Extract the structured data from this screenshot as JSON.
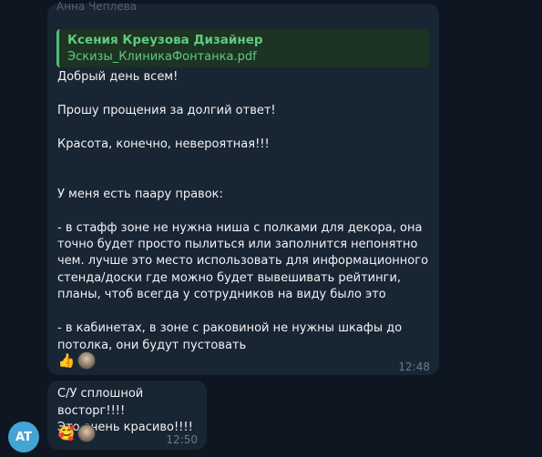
{
  "message1": {
    "sender": "Анна Чеплева",
    "reply": {
      "author": "Ксения Креузова Дизайнер",
      "file": "Эскизы_КлиникаФонтанка.pdf"
    },
    "text": "Добрый день всем!\n\nПрошу прощения за долгий ответ!\n\nКрасота, конечно, невероятная!!!\n\n\nУ меня есть паару правок:\n\n- в стафф зоне не нужна ниша с полками для декора, она точно будет просто пылиться или заполнится непонятно чем. лучше это место использовать для информационного стенда/доски где можно будет вывешивать рейтинги, планы, чтоб всегда у сотрудников на виду было это\n\n- в кабинетах, в зоне с раковиной не нужны шкафы до потолка, они будут пустовать",
    "reaction_emoji": "👍",
    "time": "12:48"
  },
  "message2": {
    "text": "С/У сплошной восторг!!!!\nЭто очень красиво!!!!",
    "reaction_emoji": "🥰",
    "time": "12:50"
  },
  "avatar": {
    "initials": "AT",
    "color": "#43a5d5"
  },
  "colors": {
    "background": "#0e1621",
    "bubble": "#182533",
    "reply_accent": "#4fbf71"
  }
}
